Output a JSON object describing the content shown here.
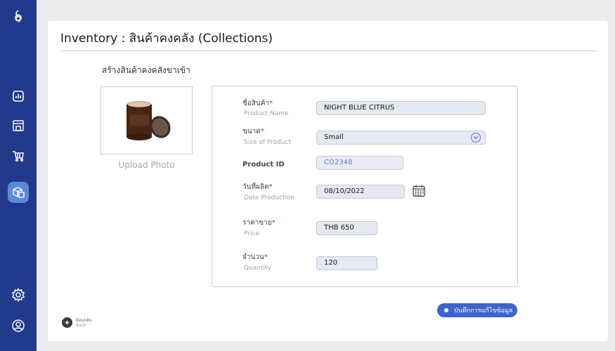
{
  "sidebar": {
    "items": [
      {
        "icon": "logo-icon"
      },
      {
        "icon": "chart-icon"
      },
      {
        "icon": "storefront-icon"
      },
      {
        "icon": "cart-icon"
      },
      {
        "icon": "inventory-boxes-icon",
        "active": true
      },
      {
        "icon": "settings-gear-icon"
      },
      {
        "icon": "user-profile-icon"
      }
    ],
    "colors": {
      "background": "#223a8c",
      "active": "#5b8ad8"
    }
  },
  "header": {
    "title": "Inventory : สินค้าคงคลัง (Collections)"
  },
  "section": {
    "title": "สร้างสินค้าคงคลังขาเข้า"
  },
  "photo": {
    "upload_label": "Upload Photo",
    "image": "candle-jar-product-image"
  },
  "form": {
    "product_name": {
      "label": "ชื่อสินค้า",
      "sublabel": "Product Name",
      "value": "NIGHT BLUE CITRUS"
    },
    "size": {
      "label": "ขนาด",
      "sublabel": "Size of Product",
      "value": "Small"
    },
    "product_id": {
      "label": "Product ID",
      "value": "CO2348"
    },
    "date": {
      "label": "วันที่ผลิต",
      "sublabel": "Date Production",
      "value": "08/10/2022"
    },
    "price": {
      "label": "ราคาขาย",
      "sublabel": "Price",
      "value": "THB 650"
    },
    "quantity": {
      "label": "จำนวน",
      "sublabel": "Quantity",
      "value": "120"
    },
    "required_mark": "*"
  },
  "actions": {
    "save_label": "บันทึกการแก้ไขข้อมูล",
    "back_label_th": "ย้อนกลับ",
    "back_label_en": "Back"
  },
  "colors": {
    "accent": "#3f63cf",
    "required": "#d62828",
    "field_bg": "#e4e9f2"
  }
}
